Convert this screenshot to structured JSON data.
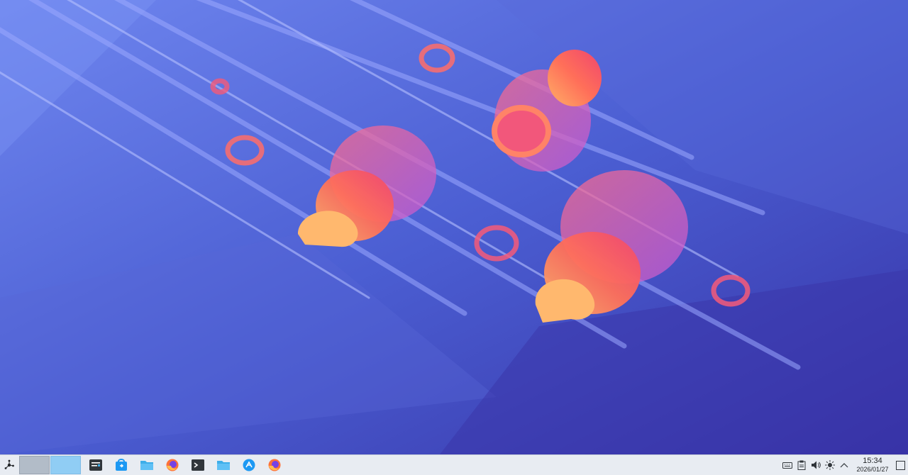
{
  "desktop": {
    "wallpaper": "kde-plasma-abstract-scrolls",
    "colors": {
      "bg_top": "#6f7ff0",
      "bg_bottom": "#3a3fb0",
      "accent_warm": "#ff7a59",
      "accent_pink": "#f14f7a"
    }
  },
  "taskbar": {
    "launcher_icon": "application-launcher-icon",
    "pager": [
      {
        "name": "desktop-1",
        "active": false
      },
      {
        "name": "desktop-2",
        "active": true
      }
    ],
    "tasks": [
      {
        "name": "system-monitor-icon"
      },
      {
        "name": "software-store-icon"
      },
      {
        "name": "file-manager-icon"
      },
      {
        "name": "firefox-icon"
      },
      {
        "name": "terminal-icon"
      },
      {
        "name": "file-manager-icon"
      },
      {
        "name": "kde-connect-icon"
      },
      {
        "name": "firefox-icon"
      }
    ],
    "tray": [
      {
        "name": "keyboard-icon"
      },
      {
        "name": "clipboard-icon"
      },
      {
        "name": "volume-icon"
      },
      {
        "name": "brightness-icon"
      },
      {
        "name": "expand-tray-icon"
      }
    ],
    "clock": {
      "time": "15:34",
      "date": "2026/01/27"
    },
    "show_desktop_icon": "show-desktop-icon"
  }
}
